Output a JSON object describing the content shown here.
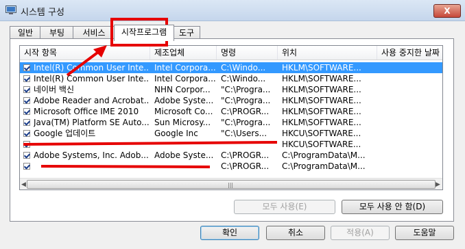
{
  "window": {
    "title": "시스템 구성",
    "close_label": "X"
  },
  "tabs": [
    "일반",
    "부팅",
    "서비스",
    "시작프로그램",
    "도구"
  ],
  "listview": {
    "columns": [
      "시작 항목",
      "제조업체",
      "명령",
      "위치",
      "사용 중지한 날짜"
    ],
    "rows": [
      {
        "item": "Intel(R) Common User Inte...",
        "maker": "Intel Corpora...",
        "command": "C:\\Windo...",
        "location": "HKLM\\SOFTWARE...",
        "selected": true
      },
      {
        "item": "Intel(R) Common User Inte...",
        "maker": "Intel Corpora...",
        "command": "C:\\Windo...",
        "location": "HKLM\\SOFTWARE..."
      },
      {
        "item": "네이버 백신",
        "maker": "NHN Corpor...",
        "command": "\"C:\\Progra...",
        "location": "HKLM\\SOFTWARE..."
      },
      {
        "item": "Adobe Reader and Acrobat...",
        "maker": "Adobe Syste...",
        "command": "\"C:\\Progra...",
        "location": "HKLM\\SOFTWARE..."
      },
      {
        "item": "Microsoft Office IME 2010",
        "maker": "Microsoft Co...",
        "command": "C:\\PROGR...",
        "location": "HKLM\\SOFTWARE..."
      },
      {
        "item": "Java(TM) Platform SE Auto...",
        "maker": "Sun Microsy...",
        "command": "\"C:\\Progra...",
        "location": "HKLM\\SOFTWARE..."
      },
      {
        "item": "Google 업데이트",
        "maker": "Google Inc",
        "command": "\"C:\\Users...",
        "location": "HKCU\\SOFTWARE..."
      },
      {
        "item": "",
        "maker": "",
        "command": "",
        "location": "HKCU\\SOFTWARE..."
      },
      {
        "item": "Adobe Systems, Inc. Adob...",
        "maker": "Adobe Syste...",
        "command": "C:\\PROGR...",
        "location": "C:\\ProgramData\\M..."
      },
      {
        "item": "",
        "maker": "",
        "command": "C:\\PROGR...",
        "location": "C:\\ProgramData\\M..."
      }
    ]
  },
  "buttons": {
    "enable_all": "모두 사용(E)",
    "disable_all": "모두 사용 안 함(D)",
    "ok": "확인",
    "cancel": "취소",
    "apply": "적용(A)",
    "help": "도움말"
  },
  "colors": {
    "selection": "#3399ff",
    "annotation": "#e60000",
    "titlebar": "#c5d6ec"
  }
}
